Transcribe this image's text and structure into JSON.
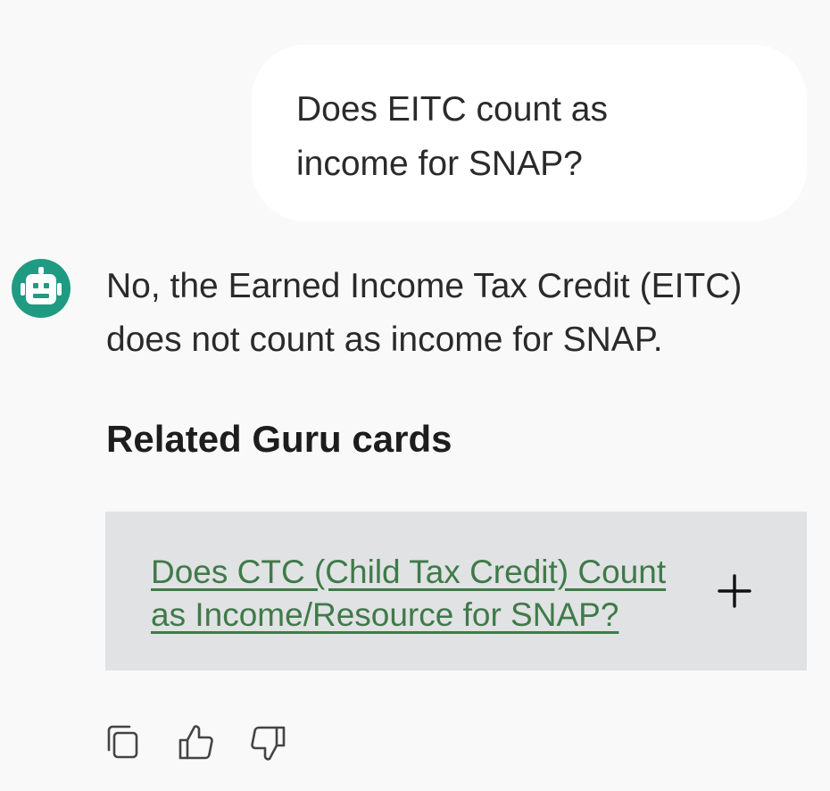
{
  "conversation": {
    "user_message": "Does EITC count as income for SNAP?",
    "assistant_message": "No, the Earned Income Tax Credit (EITC) does not count as income for SNAP.",
    "assistant_avatar_icon": "robot-icon",
    "assistant_avatar_color": "#1f9b82"
  },
  "related": {
    "heading": "Related Guru cards",
    "cards": [
      {
        "title": "Does CTC (Child Tax Credit) Count as Income/Resource for SNAP?",
        "link_color": "#3f7a4a",
        "expand_icon": "plus-icon"
      }
    ]
  },
  "actions": {
    "items": [
      {
        "icon": "copy-icon"
      },
      {
        "icon": "thumbs-up-icon"
      },
      {
        "icon": "thumbs-down-icon"
      }
    ]
  }
}
